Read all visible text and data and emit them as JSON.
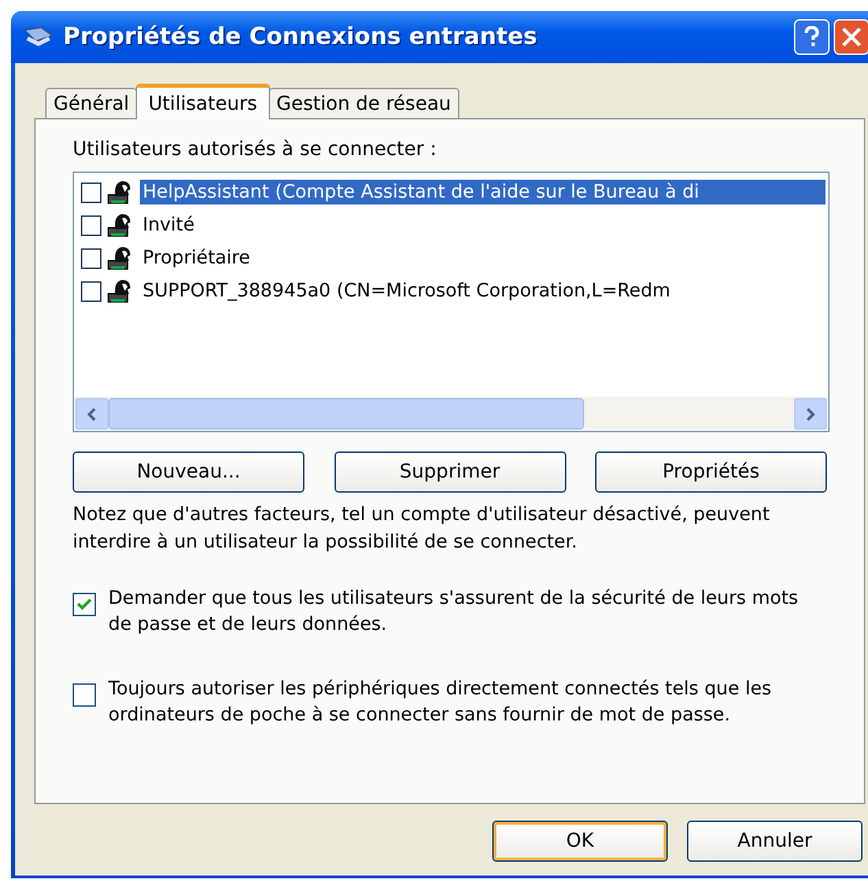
{
  "window": {
    "title": "Propriétés de Connexions entrantes"
  },
  "tabs": [
    {
      "label": "Général",
      "selected": false
    },
    {
      "label": "Utilisateurs",
      "selected": true
    },
    {
      "label": "Gestion de réseau",
      "selected": false
    }
  ],
  "users_label": "Utilisateurs autorisés à se connecter :",
  "users": [
    {
      "name": "HelpAssistant (Compte Assistant de l'aide sur le Bureau à di",
      "checked": false,
      "selected": true
    },
    {
      "name": "Invité",
      "checked": false,
      "selected": false
    },
    {
      "name": "Propriétaire",
      "checked": false,
      "selected": false
    },
    {
      "name": "SUPPORT_388945a0 (CN=Microsoft Corporation,L=Redm",
      "checked": false,
      "selected": false
    }
  ],
  "list_buttons": [
    "Nouveau...",
    "Supprimer",
    "Propriétés"
  ],
  "note": "Notez que d'autres facteurs, tel un compte d'utilisateur désactivé, peuvent interdire à un utilisateur la possibilité de se connecter.",
  "options": [
    {
      "label": "Demander que tous les utilisateurs s'assurent de la sécurité de leurs mots de passe et de leurs données.",
      "checked": true
    },
    {
      "label": "Toujours autoriser les périphériques directement connectés tels que les ordinateurs de poche à se connecter sans fournir de mot de passe.",
      "checked": false
    }
  ],
  "dialog_buttons": [
    {
      "label": "OK",
      "default": true
    },
    {
      "label": "Annuler",
      "default": false
    }
  ]
}
